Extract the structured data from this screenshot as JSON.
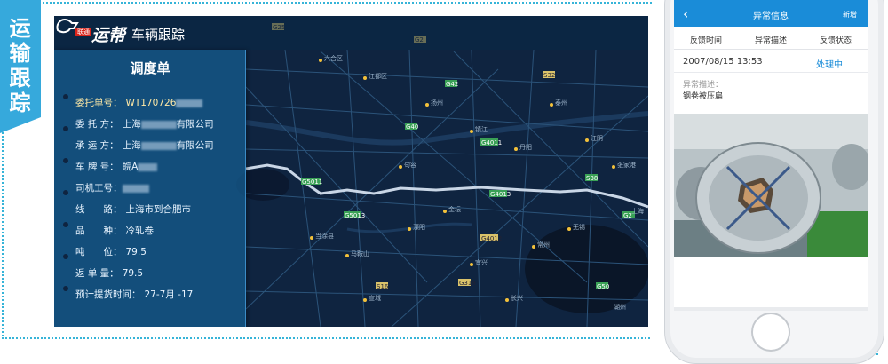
{
  "side_tag": {
    "text": "运输跟踪"
  },
  "app": {
    "logo_text": "运帮",
    "logo_badge": "联通",
    "subtitle": "车辆跟踪"
  },
  "dispatch": {
    "title": "调度单",
    "fields": [
      {
        "label": "委托单号：",
        "value": "WT170726"
      },
      {
        "label": "委 托 方：",
        "value_prefix": "上海",
        "value_suffix": "有限公司"
      },
      {
        "label": "承 运 方：",
        "value_prefix": "上海",
        "value_suffix": "有限公司"
      },
      {
        "label": "车 牌 号：",
        "value_prefix": "皖A"
      },
      {
        "label": "司机工号：",
        "value_prefix": ""
      },
      {
        "label": "线　　路：",
        "value": "上海市到合肥市"
      },
      {
        "label": "品　　种：",
        "value": "冷轧卷"
      },
      {
        "label": "吨　　位：",
        "value": "79.5"
      },
      {
        "label": "返 单 量：",
        "value": "79.5"
      },
      {
        "label": "预计提货时间：",
        "value": "27-7月 -17"
      }
    ]
  },
  "map": {
    "road_labels": [
      "G25",
      "G2",
      "G40",
      "G42",
      "G2513",
      "G4011",
      "G4013",
      "G50",
      "G60",
      "S35",
      "S38",
      "S32",
      "G2501",
      "G205",
      "G318",
      "G104",
      "G328",
      "S58",
      "S39",
      "S55",
      "G233",
      "S201",
      "S16",
      "G3",
      "S28",
      "G312",
      "G325"
    ],
    "city_labels": [
      "六合区",
      "江都区",
      "扬州",
      "镇江",
      "常州",
      "无锡",
      "苏州",
      "溧阳",
      "宜兴",
      "湖州",
      "金坛",
      "句容",
      "南京",
      "马鞍山",
      "芜湖",
      "宣城",
      "高淳区",
      "溧水区",
      "丹阳",
      "当涂县",
      "江宁区",
      "滁州",
      "天长",
      "泰州",
      "靖江",
      "张家港",
      "江阴",
      "太仓",
      "上海",
      "吴江",
      "嘉兴",
      "长兴",
      "安吉",
      "广德",
      "郎溪",
      "宁国",
      "铜陵",
      "繁昌",
      "南陵",
      "泾县",
      "旌德",
      "绩溪",
      "杭州",
      "德清",
      "桐乡",
      "海宁",
      "平湖"
    ]
  },
  "phone": {
    "topbar_title": "异常信息",
    "topbar_add": "新增",
    "tabs": [
      "反馈时间",
      "异常描述",
      "反馈状态"
    ],
    "date": "2007/08/15 13:53",
    "status": "处理中",
    "desc_label": "异常描述：",
    "desc_value": "钢卷被压扁"
  },
  "colors": {
    "accent": "#36a9dc",
    "map_bg": "#0f2440",
    "phone_topbar": "#1a8cd8"
  }
}
